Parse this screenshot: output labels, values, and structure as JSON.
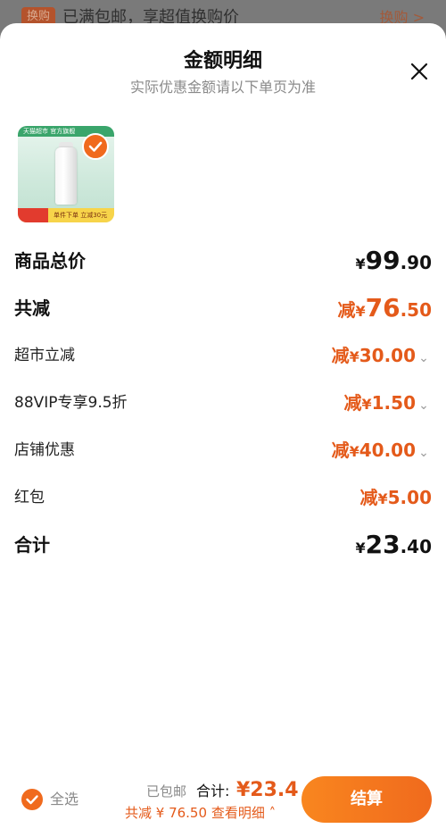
{
  "background": {
    "tag": "换购",
    "text": "已满包邮，享超值换购价",
    "right": "换购 >"
  },
  "sheet": {
    "title": "金额明细",
    "subtitle": "实际优惠金额请以下单页为准"
  },
  "product": {
    "band_text": "天猫超市 官方旗舰",
    "promo_text": "单件下单 立减30元"
  },
  "rows": {
    "total_price": {
      "label": "商品总价",
      "yen": "¥",
      "int": "99",
      "dec": ".90"
    },
    "total_reduce": {
      "label": "共减",
      "prefix": "减",
      "yen": "¥",
      "int": "76",
      "dec": ".50"
    },
    "supermarket": {
      "label": "超市立减",
      "prefix": "减",
      "yen": "¥",
      "amount": "30.00"
    },
    "vip": {
      "label": "88VIP专享9.5折",
      "prefix": "减",
      "yen": "¥",
      "amount": "1.50"
    },
    "store": {
      "label": "店铺优惠",
      "prefix": "减",
      "yen": "¥",
      "amount": "40.00"
    },
    "redpacket": {
      "label": "红包",
      "prefix": "减",
      "yen": "¥",
      "amount": "5.00"
    },
    "sum": {
      "label": "合计",
      "yen": "¥",
      "int": "23",
      "dec": ".40"
    }
  },
  "footer": {
    "select_all": "全选",
    "shipping": "已包邮",
    "total_label": "合计:",
    "total_value": "¥23.4",
    "reduce_text": "共减 ¥ 76.50",
    "detail_text": "查看明细",
    "checkout": "结算"
  },
  "colors": {
    "accent": "#f06a1d",
    "accent_text": "#e45a1a",
    "overlay": "#6a6a6a"
  },
  "icons": {
    "close": "close-icon",
    "check": "check-icon",
    "chevron_down": "chevron-down-icon",
    "chevron_up": "chevron-up-icon"
  }
}
